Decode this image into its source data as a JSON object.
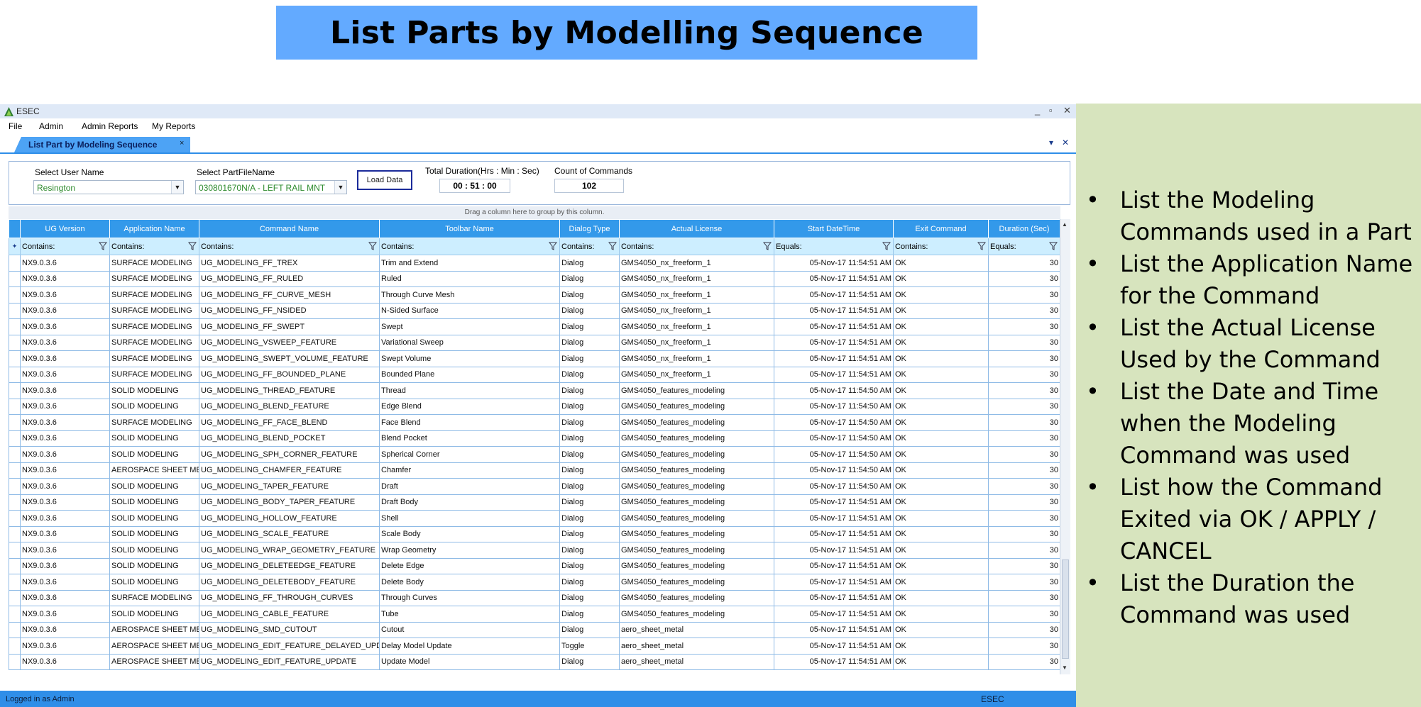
{
  "slide_title": "List Parts by Modelling Sequence",
  "bullets": [
    "List the Modeling Commands used in a Part",
    "List the Application Name for the Command",
    "List the Actual License Used by the Command",
    "List the Date and Time when the Modeling Command was used",
    "List how the Command Exited via OK / APPLY / CANCEL",
    "List the Duration the Command was used"
  ],
  "bullet_glyph": "•",
  "colors": {
    "banner": "#63aaff",
    "side_panel": "#d7e4be",
    "accent": "#2f8ee8",
    "header": "#3399ea",
    "filter_row": "#cdeeff"
  },
  "app": {
    "title": "ESEC",
    "window_controls": {
      "minimize": "_",
      "restore": "▫",
      "close": "✕"
    },
    "menu": [
      "File",
      "Admin",
      "Admin Reports",
      "My Reports"
    ],
    "tab": {
      "label": "List Part by Modeling Sequence",
      "close": "×"
    },
    "tab_controls": {
      "dropdown": "▾",
      "close": "✕"
    },
    "filters": {
      "user_label": "Select User Name",
      "user_value": "Resington",
      "part_label": "Select PartFileName",
      "part_value": "030801670N/A - LEFT RAIL MNT",
      "load_button": "Load Data",
      "duration_label": "Total Duration(Hrs : Min : Sec)",
      "duration_value": "00 : 51 : 00",
      "count_label": "Count of Commands",
      "count_value": "102"
    },
    "group_hint": "Drag a column here to group by this column.",
    "columns": [
      "UG Version",
      "Application Name",
      "Command Name",
      "Toolbar Name",
      "Dialog Type",
      "Actual License",
      "Start DateTime",
      "Exit Command",
      "Duration (Sec)"
    ],
    "filter_ops": [
      "Contains:",
      "Contains:",
      "Contains:",
      "Contains:",
      "Contains:",
      "Contains:",
      "Equals:",
      "Contains:",
      "Equals:"
    ],
    "filter_row_marker": "✦",
    "rows": [
      [
        "NX9.0.3.6",
        "SURFACE MODELING",
        "UG_MODELING_FF_TREX",
        "Trim and Extend",
        "Dialog",
        "GMS4050_nx_freeform_1",
        "05-Nov-17 11:54:51 AM",
        "OK",
        "30"
      ],
      [
        "NX9.0.3.6",
        "SURFACE MODELING",
        "UG_MODELING_FF_RULED",
        "Ruled",
        "Dialog",
        "GMS4050_nx_freeform_1",
        "05-Nov-17 11:54:51 AM",
        "OK",
        "30"
      ],
      [
        "NX9.0.3.6",
        "SURFACE MODELING",
        "UG_MODELING_FF_CURVE_MESH",
        "Through Curve Mesh",
        "Dialog",
        "GMS4050_nx_freeform_1",
        "05-Nov-17 11:54:51 AM",
        "OK",
        "30"
      ],
      [
        "NX9.0.3.6",
        "SURFACE MODELING",
        "UG_MODELING_FF_NSIDED",
        "N-Sided Surface",
        "Dialog",
        "GMS4050_nx_freeform_1",
        "05-Nov-17 11:54:51 AM",
        "OK",
        "30"
      ],
      [
        "NX9.0.3.6",
        "SURFACE MODELING",
        "UG_MODELING_FF_SWEPT",
        "Swept",
        "Dialog",
        "GMS4050_nx_freeform_1",
        "05-Nov-17 11:54:51 AM",
        "OK",
        "30"
      ],
      [
        "NX9.0.3.6",
        "SURFACE MODELING",
        "UG_MODELING_VSWEEP_FEATURE",
        "Variational Sweep",
        "Dialog",
        "GMS4050_nx_freeform_1",
        "05-Nov-17 11:54:51 AM",
        "OK",
        "30"
      ],
      [
        "NX9.0.3.6",
        "SURFACE MODELING",
        "UG_MODELING_SWEPT_VOLUME_FEATURE",
        "Swept Volume",
        "Dialog",
        "GMS4050_nx_freeform_1",
        "05-Nov-17 11:54:51 AM",
        "OK",
        "30"
      ],
      [
        "NX9.0.3.6",
        "SURFACE MODELING",
        "UG_MODELING_FF_BOUNDED_PLANE",
        "Bounded Plane",
        "Dialog",
        "GMS4050_nx_freeform_1",
        "05-Nov-17 11:54:51 AM",
        "OK",
        "30"
      ],
      [
        "NX9.0.3.6",
        "SOLID MODELING",
        "UG_MODELING_THREAD_FEATURE",
        "Thread",
        "Dialog",
        "GMS4050_features_modeling",
        "05-Nov-17 11:54:50 AM",
        "OK",
        "30"
      ],
      [
        "NX9.0.3.6",
        "SOLID MODELING",
        "UG_MODELING_BLEND_FEATURE",
        "Edge Blend",
        "Dialog",
        "GMS4050_features_modeling",
        "05-Nov-17 11:54:50 AM",
        "OK",
        "30"
      ],
      [
        "NX9.0.3.6",
        "SURFACE MODELING",
        "UG_MODELING_FF_FACE_BLEND",
        "Face Blend",
        "Dialog",
        "GMS4050_features_modeling",
        "05-Nov-17 11:54:50 AM",
        "OK",
        "30"
      ],
      [
        "NX9.0.3.6",
        "SOLID MODELING",
        "UG_MODELING_BLEND_POCKET",
        "Blend Pocket",
        "Dialog",
        "GMS4050_features_modeling",
        "05-Nov-17 11:54:50 AM",
        "OK",
        "30"
      ],
      [
        "NX9.0.3.6",
        "SOLID MODELING",
        "UG_MODELING_SPH_CORNER_FEATURE",
        "Spherical Corner",
        "Dialog",
        "GMS4050_features_modeling",
        "05-Nov-17 11:54:50 AM",
        "OK",
        "30"
      ],
      [
        "NX9.0.3.6",
        "AEROSPACE SHEET ME...",
        "UG_MODELING_CHAMFER_FEATURE",
        "Chamfer",
        "Dialog",
        "GMS4050_features_modeling",
        "05-Nov-17 11:54:50 AM",
        "OK",
        "30"
      ],
      [
        "NX9.0.3.6",
        "SOLID MODELING",
        "UG_MODELING_TAPER_FEATURE",
        "Draft",
        "Dialog",
        "GMS4050_features_modeling",
        "05-Nov-17 11:54:50 AM",
        "OK",
        "30"
      ],
      [
        "NX9.0.3.6",
        "SOLID MODELING",
        "UG_MODELING_BODY_TAPER_FEATURE",
        "Draft Body",
        "Dialog",
        "GMS4050_features_modeling",
        "05-Nov-17 11:54:51 AM",
        "OK",
        "30"
      ],
      [
        "NX9.0.3.6",
        "SOLID MODELING",
        "UG_MODELING_HOLLOW_FEATURE",
        "Shell",
        "Dialog",
        "GMS4050_features_modeling",
        "05-Nov-17 11:54:51 AM",
        "OK",
        "30"
      ],
      [
        "NX9.0.3.6",
        "SOLID MODELING",
        "UG_MODELING_SCALE_FEATURE",
        "Scale Body",
        "Dialog",
        "GMS4050_features_modeling",
        "05-Nov-17 11:54:51 AM",
        "OK",
        "30"
      ],
      [
        "NX9.0.3.6",
        "SOLID MODELING",
        "UG_MODELING_WRAP_GEOMETRY_FEATURE",
        "Wrap Geometry",
        "Dialog",
        "GMS4050_features_modeling",
        "05-Nov-17 11:54:51 AM",
        "OK",
        "30"
      ],
      [
        "NX9.0.3.6",
        "SOLID MODELING",
        "UG_MODELING_DELETEEDGE_FEATURE",
        "Delete Edge",
        "Dialog",
        "GMS4050_features_modeling",
        "05-Nov-17 11:54:51 AM",
        "OK",
        "30"
      ],
      [
        "NX9.0.3.6",
        "SOLID MODELING",
        "UG_MODELING_DELETEBODY_FEATURE",
        "Delete Body",
        "Dialog",
        "GMS4050_features_modeling",
        "05-Nov-17 11:54:51 AM",
        "OK",
        "30"
      ],
      [
        "NX9.0.3.6",
        "SURFACE MODELING",
        "UG_MODELING_FF_THROUGH_CURVES",
        "Through Curves",
        "Dialog",
        "GMS4050_features_modeling",
        "05-Nov-17 11:54:51 AM",
        "OK",
        "30"
      ],
      [
        "NX9.0.3.6",
        "SOLID MODELING",
        "UG_MODELING_CABLE_FEATURE",
        "Tube",
        "Dialog",
        "GMS4050_features_modeling",
        "05-Nov-17 11:54:51 AM",
        "OK",
        "30"
      ],
      [
        "NX9.0.3.6",
        "AEROSPACE SHEET ME...",
        "UG_MODELING_SMD_CUTOUT",
        "Cutout",
        "Dialog",
        "aero_sheet_metal",
        "05-Nov-17 11:54:51 AM",
        "OK",
        "30"
      ],
      [
        "NX9.0.3.6",
        "AEROSPACE SHEET ME...",
        "UG_MODELING_EDIT_FEATURE_DELAYED_UPDATE",
        "Delay Model Update",
        "Toggle",
        "aero_sheet_metal",
        "05-Nov-17 11:54:51 AM",
        "OK",
        "30"
      ],
      [
        "NX9.0.3.6",
        "AEROSPACE SHEET ME...",
        "UG_MODELING_EDIT_FEATURE_UPDATE",
        "Update Model",
        "Dialog",
        "aero_sheet_metal",
        "05-Nov-17 11:54:51 AM",
        "OK",
        "30"
      ]
    ],
    "status_left": "Logged in as Admin",
    "status_right": "ESEC"
  }
}
